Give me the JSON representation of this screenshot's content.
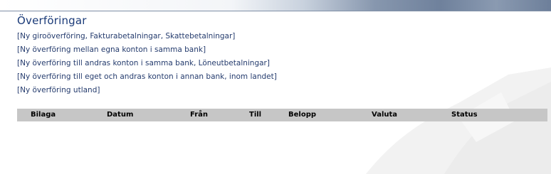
{
  "page": {
    "title": "Överföringar"
  },
  "links": [
    "[Ny giroöverföring, Fakturabetalningar, Skattebetalningar]",
    "[Ny överföring mellan egna konton i samma bank]",
    "[Ny överföring till andras konton i samma bank, Löneutbetalningar]",
    "[Ny överföring till eget och andras konton i annan bank, inom landet]",
    "[Ny överföring utland]"
  ],
  "table": {
    "columns": [
      "Bilaga",
      "Datum",
      "Från",
      "Till",
      "Belopp",
      "Valuta",
      "Status"
    ]
  },
  "colors": {
    "title": "#1a3a78",
    "link": "#243b6d",
    "header_bg": "#c6c6c6"
  }
}
